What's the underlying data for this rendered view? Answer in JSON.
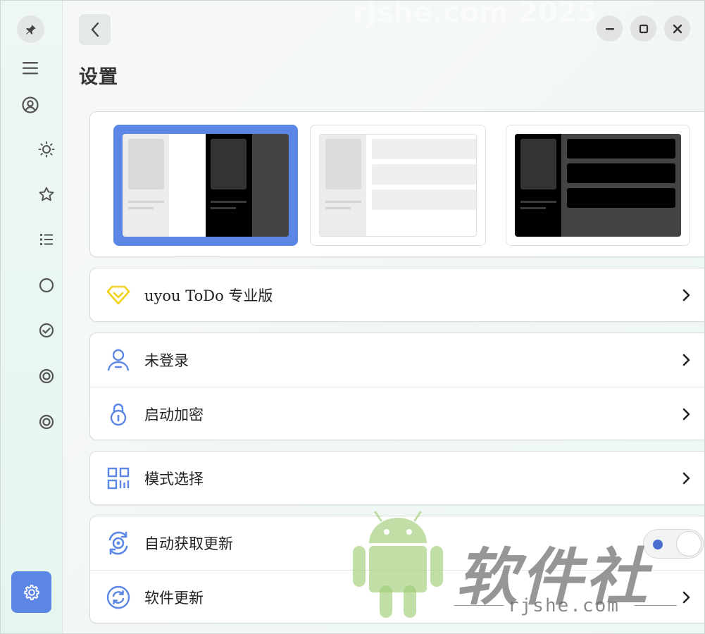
{
  "header": {
    "title": "设置"
  },
  "sidebar": {
    "items": [
      "sun-icon",
      "star-icon",
      "list-icon",
      "circle-icon",
      "check-circle-icon",
      "target-icon",
      "target-icon"
    ]
  },
  "themes": {
    "selected_index": 0,
    "options": [
      "split",
      "light",
      "dark"
    ]
  },
  "pro": {
    "label": "uyou ToDo 专业版"
  },
  "account": {
    "login_label": "未登录",
    "encryption_label": "启动加密"
  },
  "mode": {
    "label": "模式选择"
  },
  "updates": {
    "auto_label": "自动获取更新",
    "auto_enabled": false,
    "software_label": "软件更新"
  },
  "watermark": {
    "brand": "软件社",
    "url": "rjshe.com",
    "top": "rjshe.com 2025"
  },
  "colors": {
    "accent": "#5b86e5",
    "pro_icon": "#f2d21b"
  }
}
